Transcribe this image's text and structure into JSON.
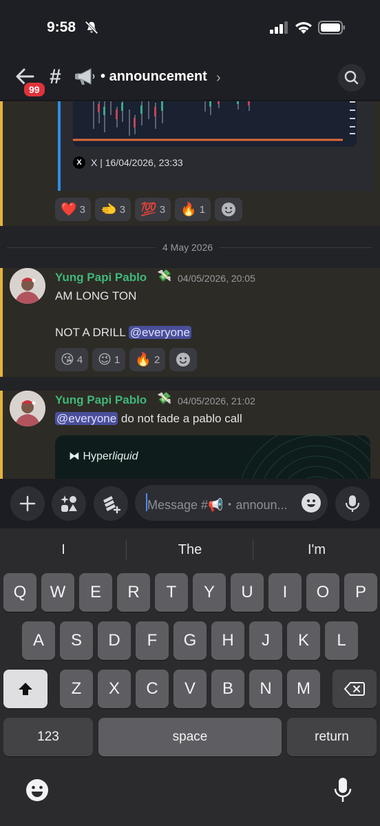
{
  "status_bar": {
    "time": "9:58"
  },
  "header": {
    "badge_count": "99",
    "channel_prefix": "#",
    "channel_dot": "•",
    "channel_name": "announcement"
  },
  "embed_top": {
    "source": "X | 16/04/2026, 23:33",
    "x_glyph": "X",
    "reactions": [
      {
        "emoji": "❤️",
        "count": "3"
      },
      {
        "emoji": "🫲",
        "count": "3"
      },
      {
        "emoji": "💯",
        "count": "3"
      },
      {
        "emoji": "🔥",
        "count": "1"
      }
    ]
  },
  "date_divider": "4 May 2026",
  "messages": [
    {
      "username": "Yung Papi Pablo",
      "role_icon": "💸",
      "timestamp": "04/05/2026, 20:05",
      "line1": "AM LONG TON",
      "line2_prefix": "NOT A DRILL ",
      "mention": "@everyone",
      "reactions": [
        {
          "emoji": "😘",
          "count": "4"
        },
        {
          "emoji": "😉",
          "count": "1"
        },
        {
          "emoji": "🔥",
          "count": "2"
        }
      ]
    },
    {
      "username": "Yung Papi Pablo",
      "role_icon": "💸",
      "timestamp": "04/05/2026, 21:02",
      "mention": "@everyone",
      "text_suffix": " do not fade a pablo call",
      "embed_brand_prefix": "Hyper",
      "embed_brand_suffix": "liquid"
    }
  ],
  "input": {
    "placeholder": "Message #📢・announ..."
  },
  "keyboard": {
    "suggestions": [
      "I",
      "The",
      "I'm"
    ],
    "row1": [
      "Q",
      "W",
      "E",
      "R",
      "T",
      "Y",
      "U",
      "I",
      "O",
      "P"
    ],
    "row2": [
      "A",
      "S",
      "D",
      "F",
      "G",
      "H",
      "J",
      "K",
      "L"
    ],
    "row3": [
      "Z",
      "X",
      "C",
      "V",
      "B",
      "N",
      "M"
    ],
    "numbers_key": "123",
    "space_key": "space",
    "return_key": "return"
  },
  "colors": {
    "accent_highlight": "#e5b33e",
    "username": "#3fb87a",
    "mention_bg": "#4a4f9a",
    "badge": "#e0333b"
  }
}
